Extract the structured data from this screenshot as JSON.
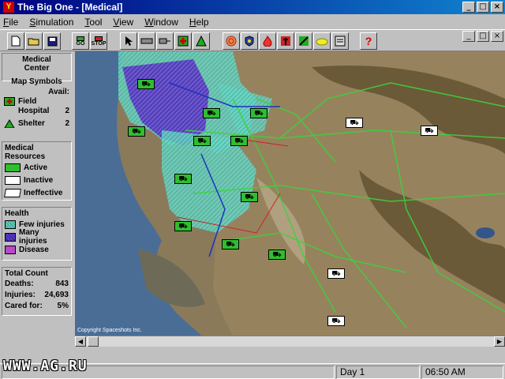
{
  "window": {
    "title": "The Big One - [Medical]",
    "minimize": "_",
    "maximize": "□",
    "close": "×"
  },
  "menu": [
    {
      "key": "F",
      "rest": "ile"
    },
    {
      "key": "S",
      "rest": "imulation"
    },
    {
      "key": "T",
      "rest": "ool"
    },
    {
      "key": "V",
      "rest": "iew"
    },
    {
      "key": "W",
      "rest": "indow"
    },
    {
      "key": "H",
      "rest": "elp"
    }
  ],
  "toolbar": {
    "go_label": "GO",
    "stop_label": "STOP",
    "help_label": "?"
  },
  "sidebar": {
    "title_line1": "Medical",
    "title_line2": "Center",
    "map_symbols": {
      "title": "Map Symbols",
      "avail_label": "Avail:",
      "field_hospital_line1": "Field",
      "field_hospital_line2": "Hospital",
      "field_hospital_count": "2",
      "shelter_label": "Shelter",
      "shelter_count": "2"
    },
    "resources": {
      "title_line1": "Medical",
      "title_line2": "Resources",
      "active": "Active",
      "inactive": "Inactive",
      "ineffective": "Ineffective"
    },
    "health": {
      "title": "Health",
      "few": "Few injuries",
      "many": "Many injuries",
      "disease": "Disease",
      "colors": {
        "few": "#5fc8b4",
        "many": "#5a3cc8",
        "disease": "#b84ac8"
      }
    },
    "totals": {
      "title": "Total Count",
      "deaths_label": "Deaths:",
      "deaths_value": "843",
      "injuries_label": "Injuries:",
      "injuries_value": "24,693",
      "cared_label": "Cared for:",
      "cared_value": "5%"
    }
  },
  "map": {
    "copyright": "Copyright Spaceshots Inc."
  },
  "status": {
    "day": "Day 1",
    "time": "06:50 AM"
  },
  "watermark": "WWW.AG.RU"
}
